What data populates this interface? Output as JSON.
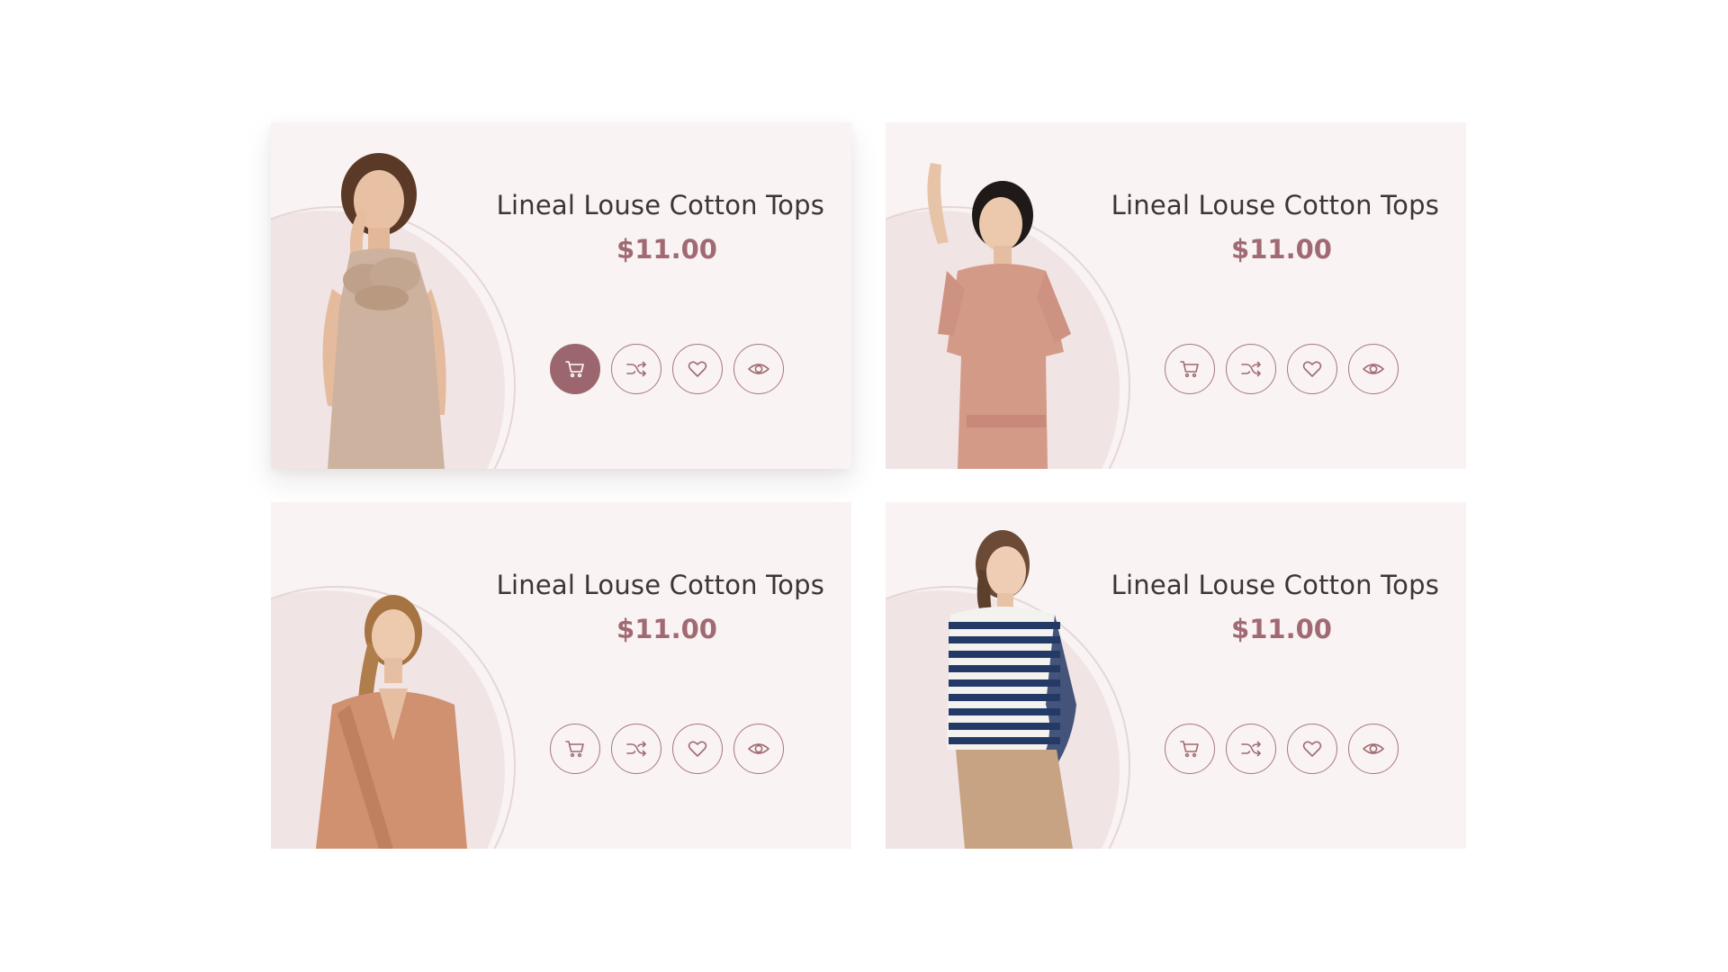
{
  "theme": {
    "card_bg": "#f9f3f3",
    "accent": "#9c666e",
    "title_color": "#3b3536",
    "price_color": "#a16a72"
  },
  "products": [
    {
      "title": "Lineal Louse Cotton Tops",
      "price": "$11.00",
      "image": "model-beige-ruffle-top",
      "active": true,
      "actions": [
        "cart-icon",
        "shuffle-icon",
        "heart-icon",
        "eye-icon"
      ]
    },
    {
      "title": "Lineal Louse Cotton Tops",
      "price": "$11.00",
      "image": "model-pink-belted-dress",
      "active": false,
      "actions": [
        "cart-icon",
        "shuffle-icon",
        "heart-icon",
        "eye-icon"
      ]
    },
    {
      "title": "Lineal Louse Cotton Tops",
      "price": "$11.00",
      "image": "model-tan-wrap-blouse",
      "active": false,
      "actions": [
        "cart-icon",
        "shuffle-icon",
        "heart-icon",
        "eye-icon"
      ]
    },
    {
      "title": "Lineal Louse Cotton Tops",
      "price": "$11.00",
      "image": "model-striped-sweater",
      "active": false,
      "actions": [
        "cart-icon",
        "shuffle-icon",
        "heart-icon",
        "eye-icon"
      ]
    }
  ]
}
